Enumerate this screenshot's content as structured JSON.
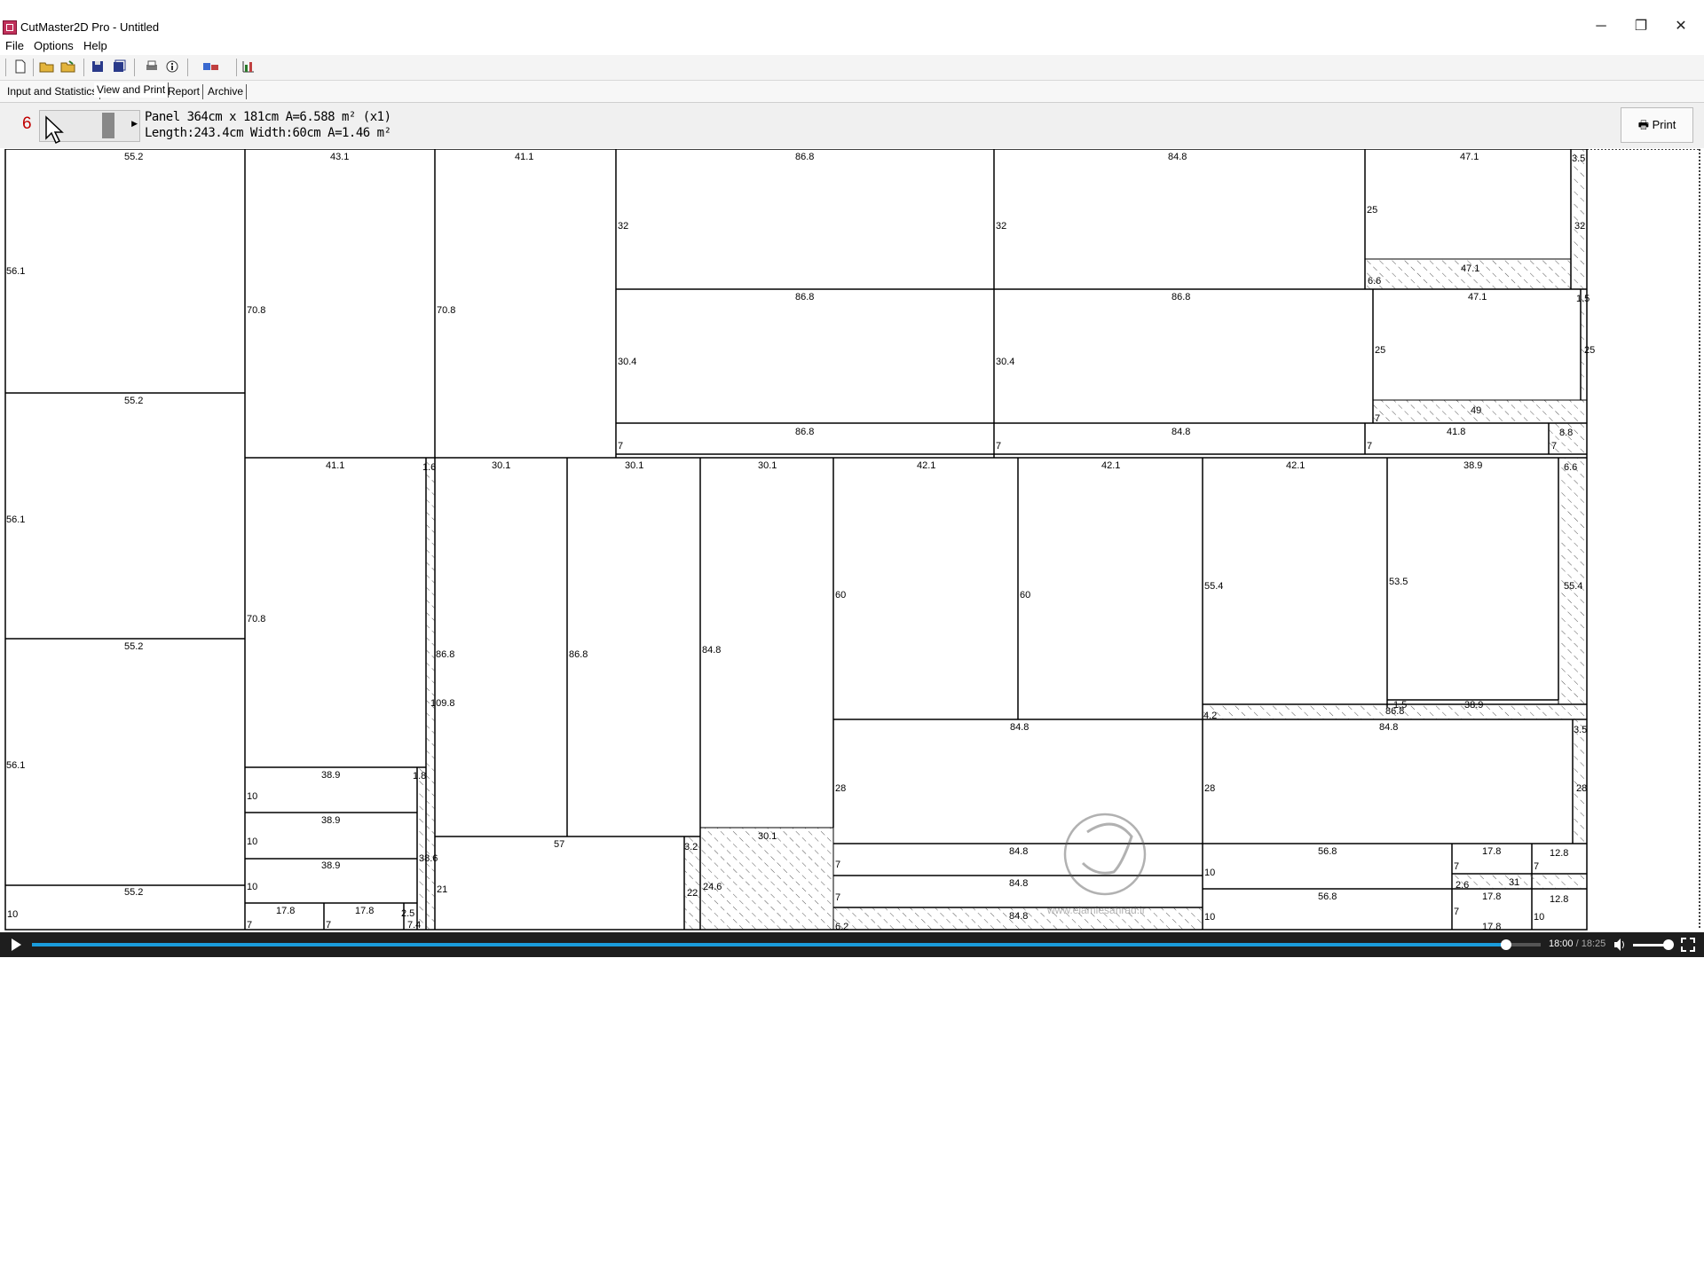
{
  "window": {
    "title": "CutMaster2D Pro - Untitled",
    "minimize": "─",
    "restore": "❐",
    "close": "✕"
  },
  "menu": [
    "File",
    "Options",
    "Help"
  ],
  "toolbar": {
    "icons": [
      "new-file-icon",
      "open-icon",
      "open-folder-icon",
      "save-icon",
      "save-as-icon",
      "print-icon",
      "info-icon",
      "export-icon",
      "chart-icon"
    ]
  },
  "tabs": [
    "Input and Statistics",
    "View and Print",
    "Report",
    "Archive"
  ],
  "active_tab": "View and Print",
  "panel": {
    "number": "6",
    "line1": "Panel 364cm x 181cm A=6.588 m² (x1)",
    "line2": "Length:243.4cm Width:60cm A=1.46 m²",
    "print_label": "Print"
  },
  "diagram": {
    "labels": [
      "55.2",
      "43.1",
      "41.1",
      "86.8",
      "84.8",
      "47.1",
      "3.5",
      "56.1",
      "70.8",
      "32",
      "25",
      "6.6",
      "1.5",
      "30.4",
      "49",
      "7",
      "41.8",
      "8.8",
      "1.6",
      "30.1",
      "42.1",
      "38.9",
      "86.8",
      "109.8",
      "84.8",
      "60",
      "55.4",
      "53.5",
      "4.2",
      "28",
      "38.9",
      "10",
      "1.8",
      "38.6",
      "57",
      "3.2",
      "22",
      "24.6",
      "17.8",
      "12.8",
      "2.6",
      "31",
      "21",
      "2.5",
      "7.4",
      "56.8",
      "6.2"
    ]
  },
  "watermark": "www.elamiesahrad.ir",
  "video": {
    "current": "18:00",
    "separator": " / ",
    "total": "18:25",
    "progress_fraction": 0.977,
    "volume_fraction": 0.85,
    "accent_color": "#1a9cdc"
  }
}
